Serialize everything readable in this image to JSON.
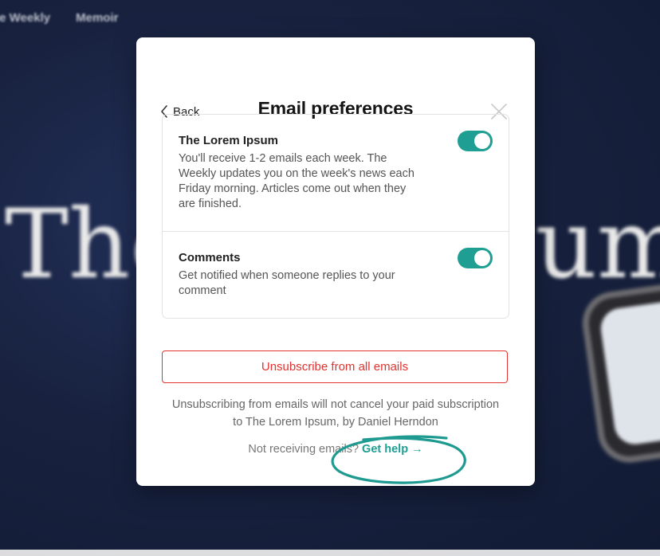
{
  "background": {
    "nav_items": [
      "he Weekly",
      "Memoir"
    ],
    "headline_left": "The",
    "headline_right": "sum"
  },
  "modal": {
    "back_label": "Back",
    "title": "Email preferences",
    "preferences": [
      {
        "title": "The Lorem Ipsum",
        "description": "You'll receive 1-2 emails each week. The Weekly updates you on the week's news each Friday morning. Articles come out when they are finished.",
        "enabled": true
      },
      {
        "title": "Comments",
        "description": "Get notified when someone replies to your comment",
        "enabled": true
      }
    ],
    "unsubscribe_label": "Unsubscribe from all emails",
    "note": "Unsubscribing from emails will not cancel your paid subscription to The Lorem Ipsum, by Daniel Herndon",
    "help_prefix": "Not receiving emails?",
    "help_link": "Get help →"
  },
  "colors": {
    "accent": "#1f9e93",
    "danger": "#e0322f",
    "annotation": "#1e9a90"
  },
  "icons": {
    "back": "chevron-left-icon",
    "close": "close-icon"
  }
}
